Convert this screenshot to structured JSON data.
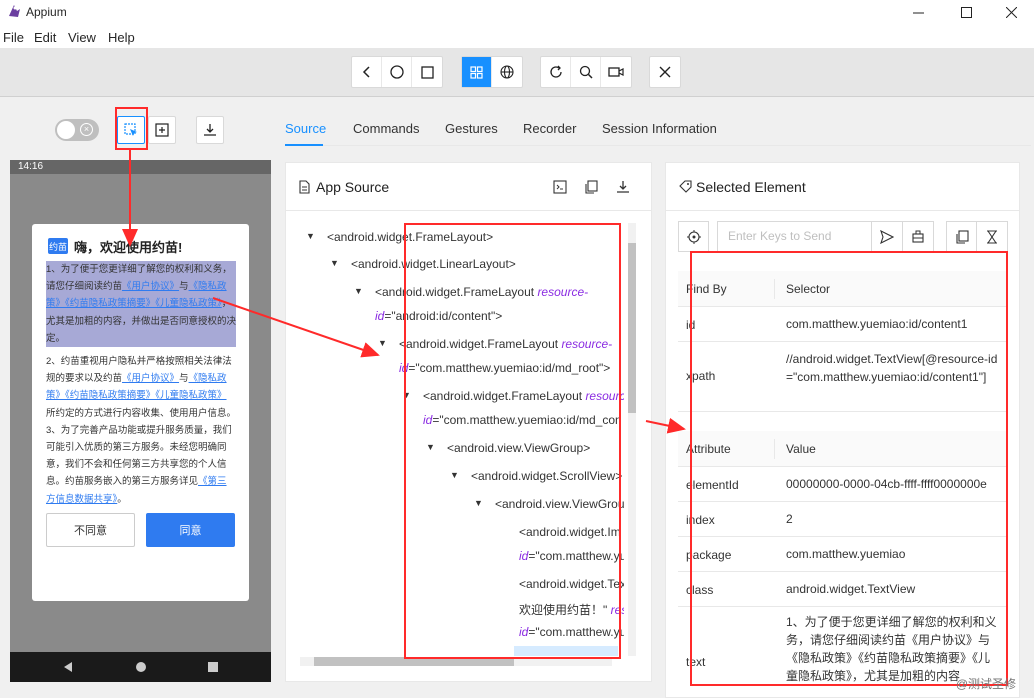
{
  "window": {
    "title": "Appium"
  },
  "menu": [
    "File",
    "Edit",
    "View",
    "Help"
  ],
  "tabs": [
    "Source",
    "Commands",
    "Gestures",
    "Recorder",
    "Session Information"
  ],
  "device": {
    "status_time": "14:16",
    "dialog": {
      "logo": "约苗",
      "title": "嗨，欢迎使用约苗!",
      "p1_plain": "1、为了便于您更详细了解您的权利和义务，请您仔细阅读约苗",
      "p1_link1": "《用户协议》",
      "p1_and": "与",
      "p1_link2": "《隐私政策》《约苗隐私政策摘要》《儿童隐私政策》",
      "p1_tail": "，尤其是加粗的内容，并做出是否同意授权的决定。",
      "p2_plain": "2、约苗重视用户隐私并严格按照相关法律法规的要求以及约苗",
      "p2_link1": "《用户协议》",
      "p2_and": "与",
      "p2_link2": "《隐私政策》《约苗隐私政策摘要》《儿童隐私政策》",
      "p2_tail": "所约定的方式进行内容收集、使用用户信息。",
      "p3_plain": "3、为了完善产品功能或提升服务质量，我们可能引入优质的第三方服务。未经您明确同意，我们不会和任何第三方共享您的个人信息。约苗服务嵌入的第三方服务详见",
      "p3_link": "《第三方信息数据共享》",
      "p3_tail": "。",
      "disagree": "不同意",
      "agree": "同意"
    }
  },
  "app_source": {
    "title": "App Source",
    "nodes": [
      {
        "tag": "<android.widget.FrameLayout>"
      },
      {
        "tag": "<android.widget.LinearLayout>"
      },
      {
        "tag": "<android.widget.FrameLayout",
        "attr": "resource-",
        "attr2": "id",
        "val": "=\"android:id/content\">"
      },
      {
        "tag": "<android.widget.FrameLayout",
        "attr": "resource-",
        "attr2": "id",
        "val": "=\"com.matthew.yuemiao:id/md_root\">"
      },
      {
        "tag": "<android.widget.FrameLayout",
        "attr": "resourc",
        "attr2": "id",
        "val": "=\"com.matthew.yuemiao:id/md_con"
      },
      {
        "tag": "<android.view.ViewGroup>"
      },
      {
        "tag": "<android.widget.ScrollView>"
      },
      {
        "tag": "<android.view.ViewGrou"
      },
      {
        "tag": "<android.widget.Im",
        "attr2": "id",
        "val": "=\"com.matthew.yu"
      },
      {
        "tag": "<android.widget.Tex",
        "text": "欢迎使用约苗！\"",
        "attr": "res",
        "attr2": "id",
        "val": "=\"com.matthew.yu"
      }
    ]
  },
  "selected": {
    "title": "Selected Element",
    "placeholder": "Enter Keys to Send",
    "find_by_header": "Find By",
    "selector_header": "Selector",
    "find_rows": [
      {
        "k": "id",
        "v": "com.matthew.yuemiao:id/content1"
      },
      {
        "k": "xpath",
        "v": "//android.widget.TextView[@resource-id=\"com.matthew.yuemiao:id/content1\"]"
      }
    ],
    "attr_header": "Attribute",
    "value_header": "Value",
    "attr_rows": [
      {
        "k": "elementId",
        "v": "00000000-0000-04cb-ffff-ffff0000000e"
      },
      {
        "k": "index",
        "v": "2"
      },
      {
        "k": "package",
        "v": "com.matthew.yuemiao"
      },
      {
        "k": "class",
        "v": "android.widget.TextView"
      },
      {
        "k": "text",
        "v": "1、为了便于您更详细了解您的权利和义务，请您仔细阅读约苗《用户协议》与《隐私政策》《约苗隐私政策摘要》《儿童隐私政策》，尤其是加粗的内容"
      }
    ]
  },
  "watermark": "@测试圣修",
  "colors": {
    "accent": "#1890ff",
    "annotation": "#ff2a2a",
    "highlight": "#a7a9d6",
    "app_blue": "#2f7bf0"
  }
}
